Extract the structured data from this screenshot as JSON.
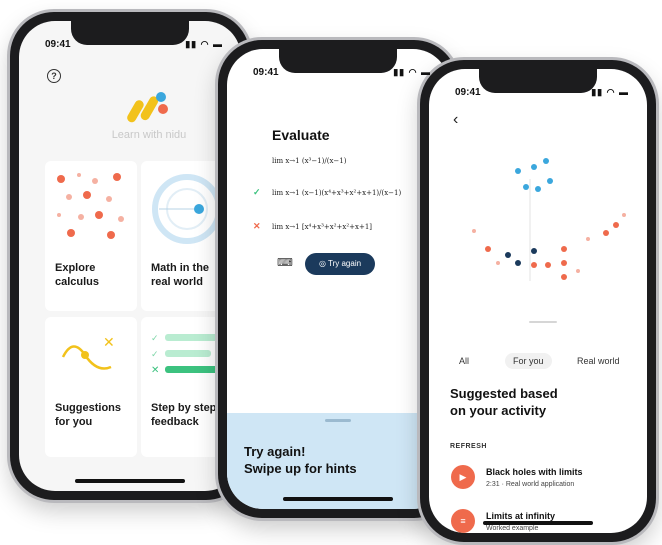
{
  "phone1": {
    "time": "09:41",
    "app_title": "Learn with nidu",
    "cards": [
      {
        "label": "Explore\ncalculus"
      },
      {
        "label": "Math in the\nreal world"
      },
      {
        "label": "Suggestions\nfor you"
      },
      {
        "label": "Step by step\nfeedback"
      }
    ]
  },
  "phone2": {
    "time": "09:41",
    "title": "Evaluate",
    "problem": "lim x→1 (x³−1)/(x−1)",
    "step_correct": "lim x→1 (x−1)(x⁴+x³+x²+x+1)/(x−1)",
    "step_wrong": "lim x→1 [x⁴+x³+x²+x²+x+1]",
    "try_again_button": "Try again",
    "hint_text": "Try again!\nSwipe up for hints"
  },
  "phone3": {
    "time": "09:41",
    "tabs": [
      "All",
      "For you",
      "Real world"
    ],
    "active_tab": "For you",
    "heading": "Suggested based\non your activity",
    "refresh_label": "REFRESH",
    "items": [
      {
        "title": "Black holes with limits",
        "subtitle": "2:31 · Real world application",
        "icon": "play-icon"
      },
      {
        "title": "Limits at infinity",
        "subtitle": "Worked example",
        "icon": "list-icon"
      }
    ]
  },
  "colors": {
    "accent": "#ef6a4c",
    "navy": "#1b3a5c",
    "hint_bg": "#cfe6f5",
    "blue_dot": "#3ba7dd",
    "yellow": "#f2c21b"
  }
}
